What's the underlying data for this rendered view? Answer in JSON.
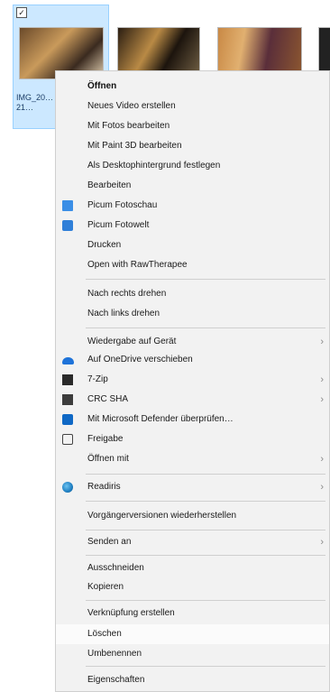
{
  "explorer": {
    "file_label": "IMG_20…\n21…"
  },
  "menu": {
    "items": [
      {
        "label": "Öffnen",
        "bold": true
      },
      {
        "label": "Neues Video erstellen"
      },
      {
        "label": "Mit Fotos bearbeiten"
      },
      {
        "label": "Mit Paint 3D bearbeiten"
      },
      {
        "label": "Als Desktophintergrund festlegen"
      },
      {
        "label": "Bearbeiten"
      },
      {
        "label": "Picum Fotoschau",
        "icon": "photo-viewer-icon"
      },
      {
        "label": "Picum Fotowelt",
        "icon": "photo-world-icon"
      },
      {
        "label": "Drucken"
      },
      {
        "label": "Open with RawTherapee"
      },
      {
        "label": "Nach rechts drehen"
      },
      {
        "label": "Nach links drehen"
      },
      {
        "label": "Wiedergabe auf Gerät",
        "submenu": true
      },
      {
        "label": "Auf OneDrive verschieben",
        "icon": "onedrive-cloud-icon"
      },
      {
        "label": "7-Zip",
        "icon": "seven-zip-icon",
        "submenu": true
      },
      {
        "label": "CRC SHA",
        "icon": "crc-sha-icon",
        "submenu": true
      },
      {
        "label": "Mit Microsoft Defender überprüfen…",
        "icon": "defender-shield-icon"
      },
      {
        "label": "Freigabe",
        "icon": "share-icon"
      },
      {
        "label": "Öffnen mit",
        "submenu": true
      },
      {
        "label": "Readiris",
        "icon": "readiris-icon",
        "submenu": true
      },
      {
        "label": "Vorgängerversionen wiederherstellen"
      },
      {
        "label": "Senden an",
        "submenu": true
      },
      {
        "label": "Ausschneiden"
      },
      {
        "label": "Kopieren"
      },
      {
        "label": "Verknüpfung erstellen"
      },
      {
        "label": "Löschen"
      },
      {
        "label": "Umbenennen"
      },
      {
        "label": "Eigenschaften"
      }
    ],
    "submenu_arrow": "›"
  }
}
